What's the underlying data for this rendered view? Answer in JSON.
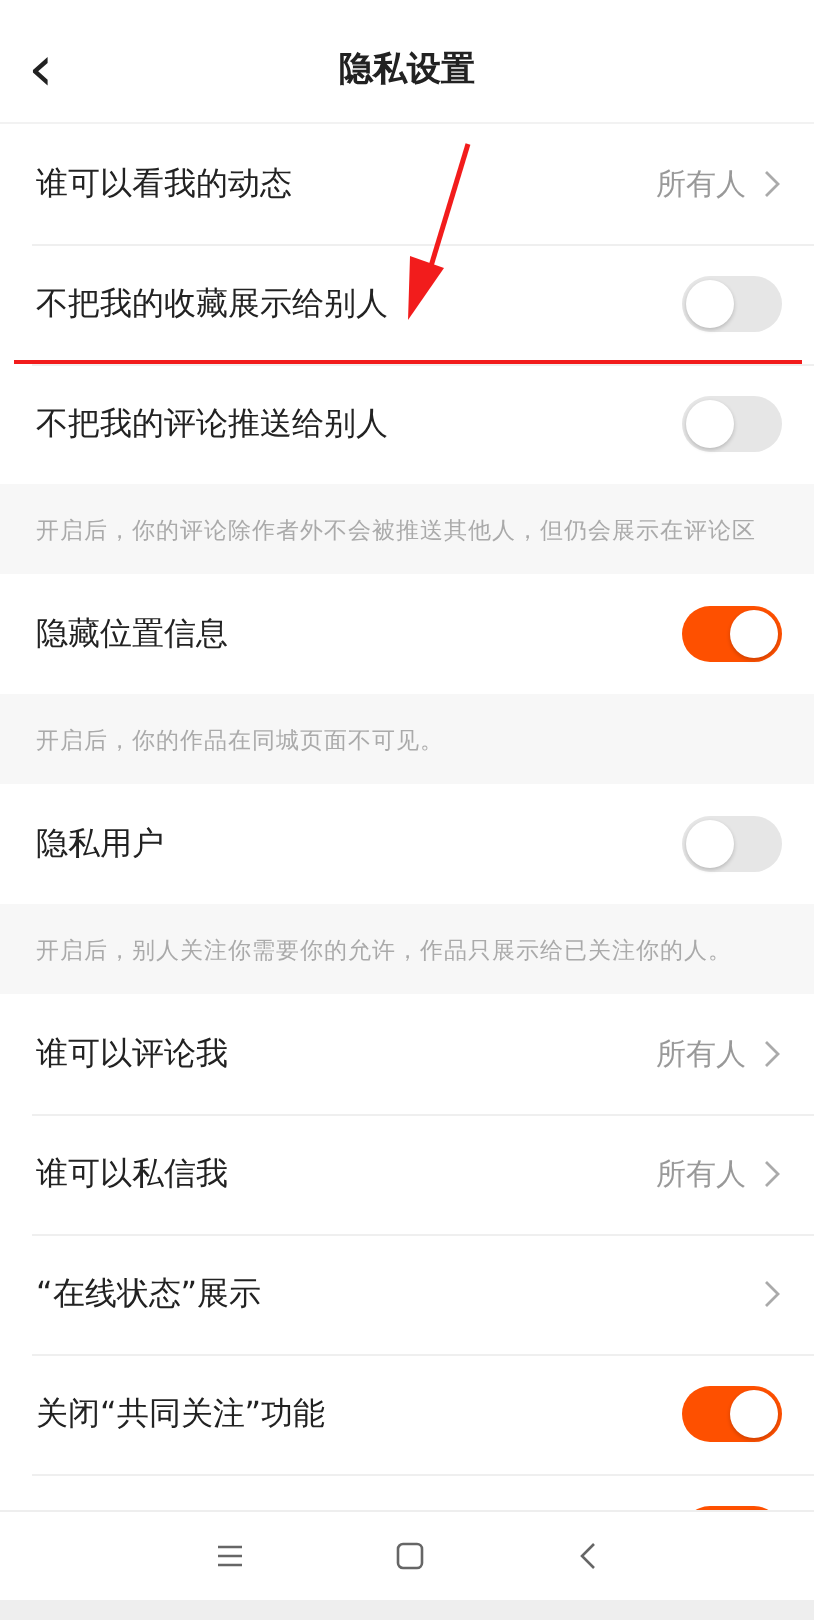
{
  "header": {
    "back": "‹",
    "title": "隐私设置"
  },
  "items": [
    {
      "kind": "link",
      "label": "谁可以看我的动态",
      "value": "所有人"
    },
    {
      "kind": "toggle",
      "label": "不把我的收藏展示给别人",
      "on": false
    },
    {
      "kind": "toggle",
      "label": "不把我的评论推送给别人",
      "on": false
    },
    {
      "kind": "hint",
      "text": "开启后，你的评论除作者外不会被推送其他人，但仍会展示在评论区"
    },
    {
      "kind": "toggle",
      "label": "隐藏位置信息",
      "on": true
    },
    {
      "kind": "hint",
      "text": "开启后，你的作品在同城页面不可见。"
    },
    {
      "kind": "toggle",
      "label": "隐私用户",
      "on": false
    },
    {
      "kind": "hint",
      "text": "开启后，别人关注你需要你的允许，作品只展示给已关注你的人。"
    },
    {
      "kind": "link",
      "label": "谁可以评论我",
      "value": "所有人"
    },
    {
      "kind": "link",
      "label": "谁可以私信我",
      "value": "所有人"
    },
    {
      "kind": "link",
      "label": "“在线状态”展示"
    },
    {
      "kind": "toggle",
      "label": "关闭“共同关注”功能",
      "on": true
    },
    {
      "kind": "toggle",
      "on": true
    }
  ]
}
